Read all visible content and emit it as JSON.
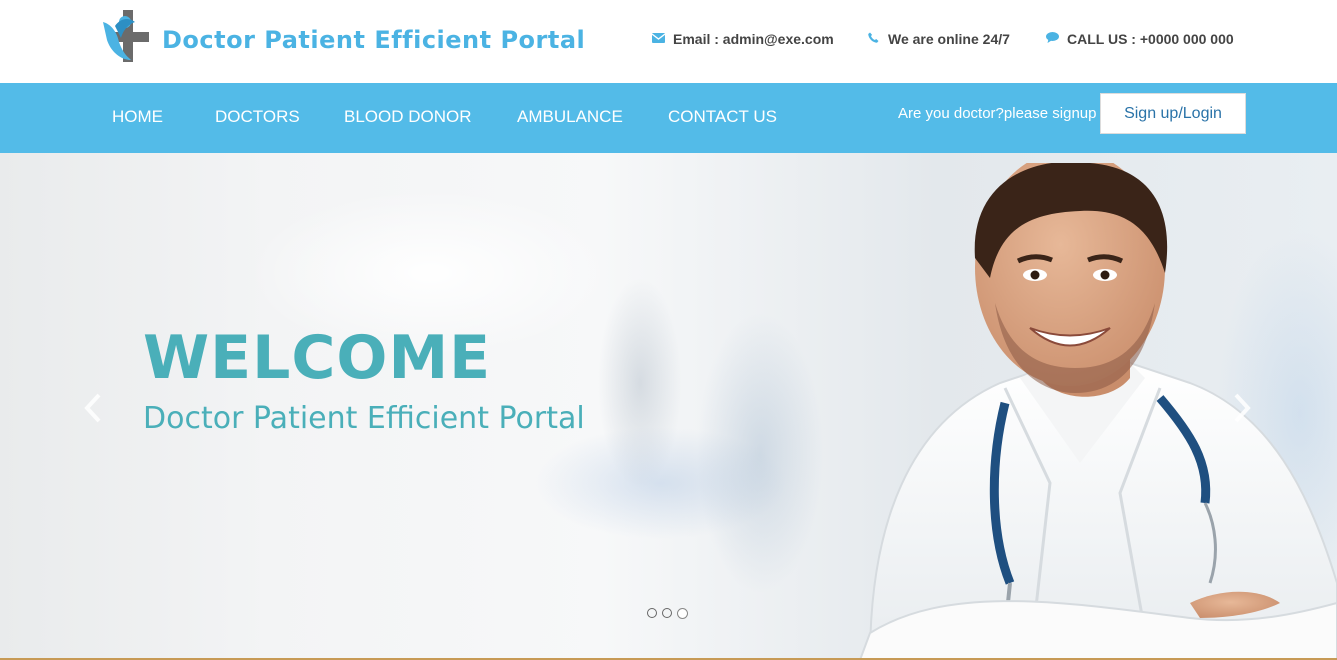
{
  "header": {
    "brand": "Doctor Patient Efficient Portal",
    "contacts": {
      "email": "Email : admin@exe.com",
      "online": "We are online 24/7",
      "call": "CALL US : +0000 000 000"
    }
  },
  "nav": {
    "items": [
      "HOME",
      "DOCTORS",
      "BLOOD DONOR",
      "AMBULANCE",
      "CONTACT US"
    ],
    "signup_prompt": "Are you doctor?please signup",
    "signup_button": "Sign up/Login"
  },
  "hero": {
    "title": "WELCOME",
    "subtitle": "Doctor Patient Efficient Portal",
    "slides_total": 3,
    "active_slide": 3
  },
  "colors": {
    "accent": "#53bbe8",
    "brand": "#4bb3e3",
    "hero_text": "#4aafb9"
  },
  "icons": [
    "logo-icon",
    "envelope-icon",
    "phone-icon",
    "chat-bubble-icon",
    "chevron-left-icon",
    "chevron-right-icon"
  ]
}
